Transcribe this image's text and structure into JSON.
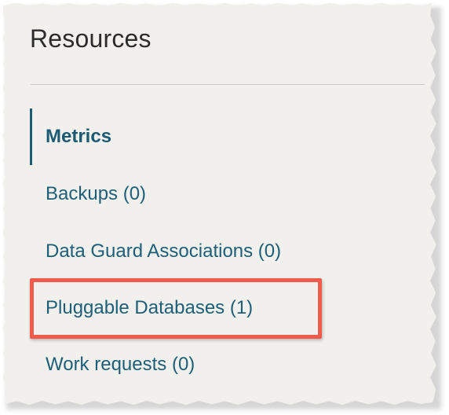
{
  "panel": {
    "title": "Resources"
  },
  "nav": {
    "items": [
      {
        "label": "Metrics",
        "active": true
      },
      {
        "label": "Backups (0)",
        "active": false
      },
      {
        "label": "Data Guard Associations (0)",
        "active": false
      },
      {
        "label": "Pluggable Databases (1)",
        "active": false,
        "highlighted": true
      },
      {
        "label": "Work requests (0)",
        "active": false
      }
    ]
  },
  "colors": {
    "link": "#1d5f78",
    "active_bar": "#1f5d75",
    "highlight": "#f15b4e",
    "background": "#f1f0ec"
  }
}
